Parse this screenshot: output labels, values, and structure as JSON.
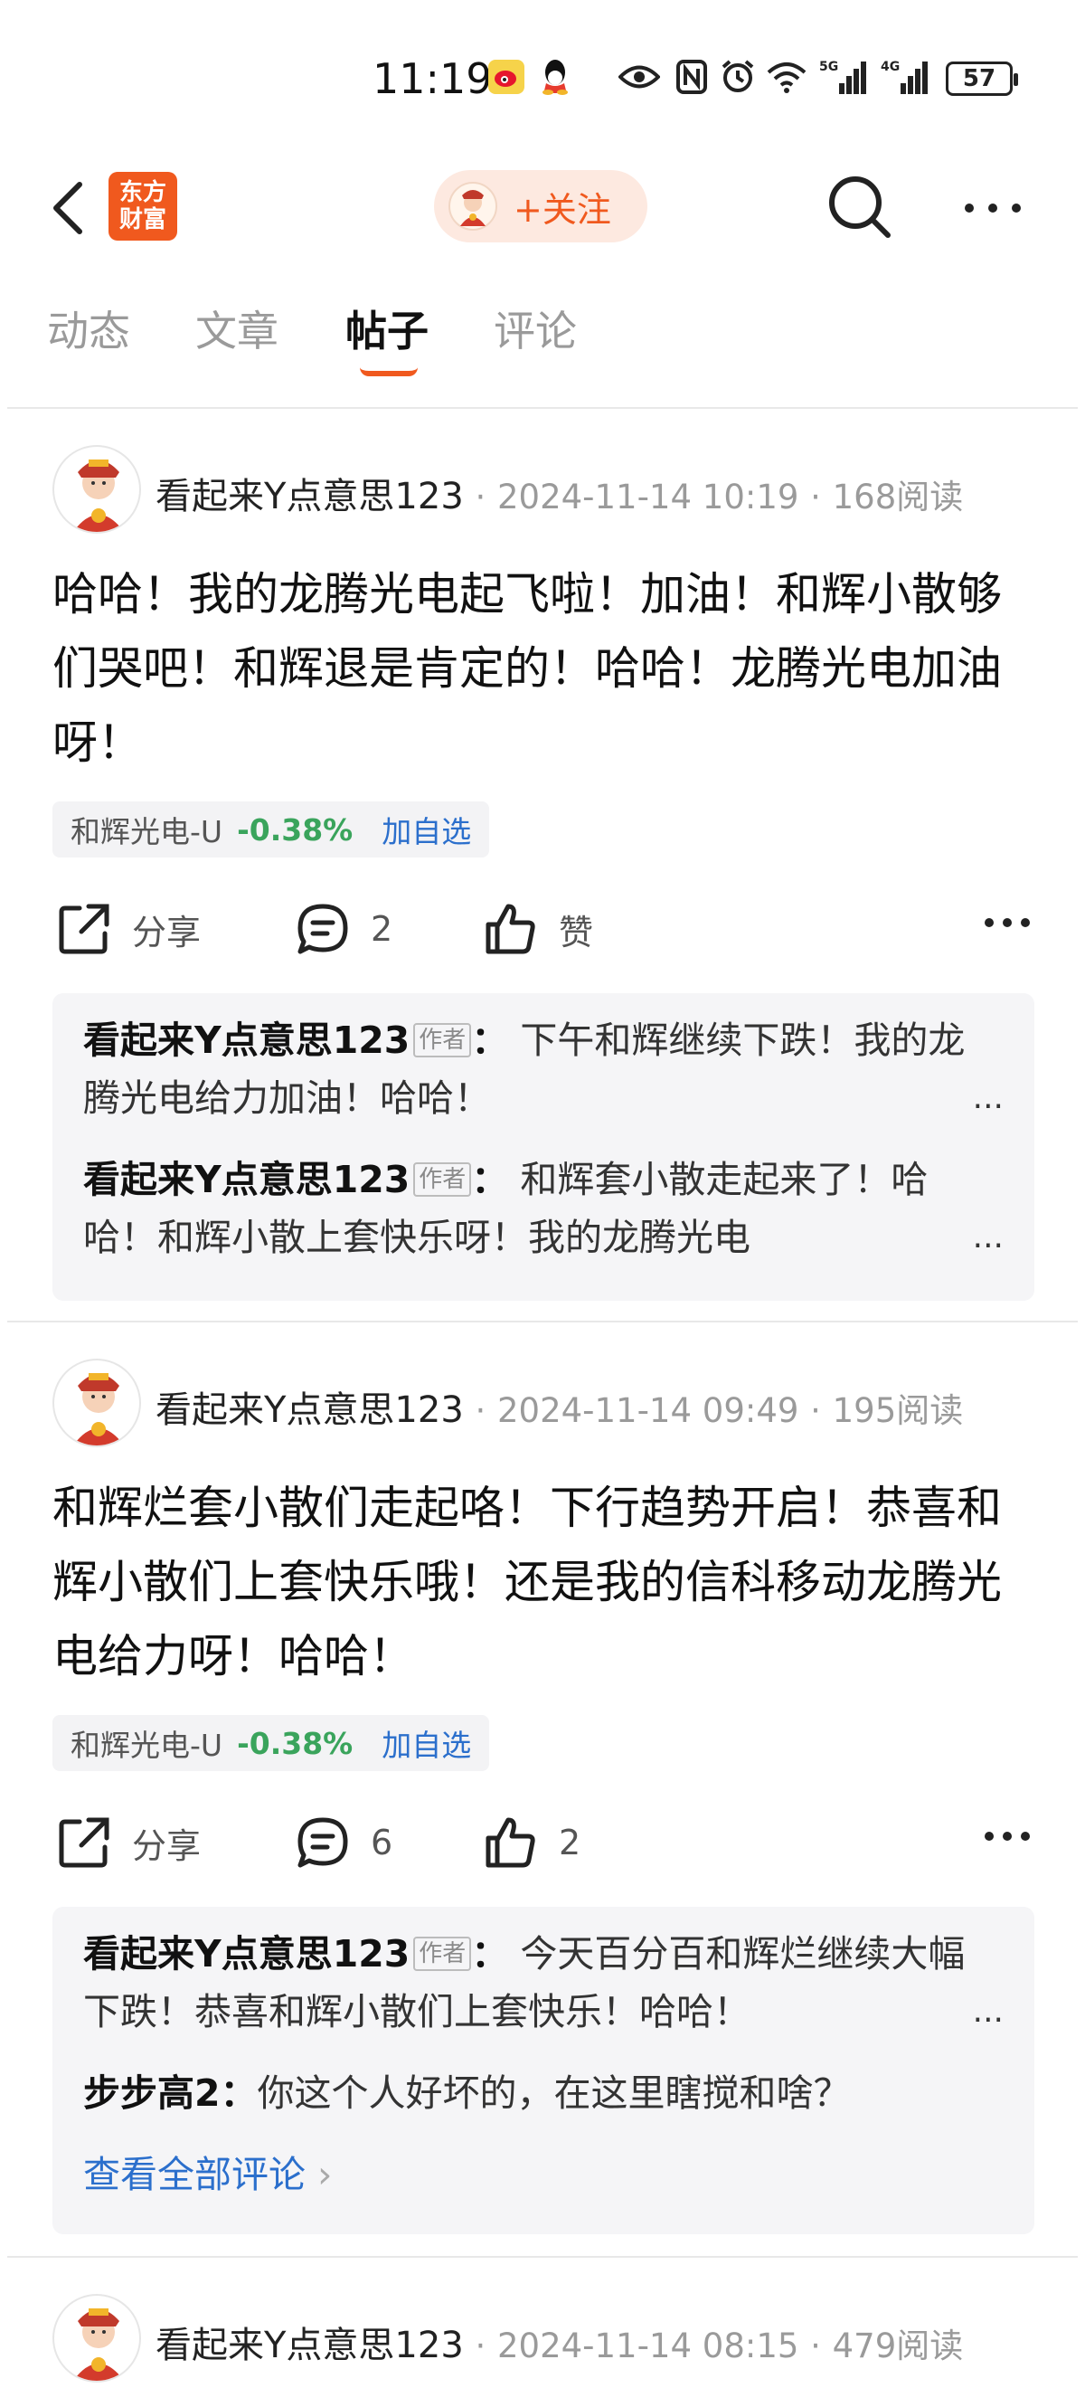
{
  "status_bar": {
    "time": "11:19",
    "battery": "57"
  },
  "header": {
    "logo_line1": "东方",
    "logo_line2": "财富",
    "follow_label": "+关注"
  },
  "tabs": [
    {
      "label": "动态"
    },
    {
      "label": "文章"
    },
    {
      "label": "帖子"
    },
    {
      "label": "评论"
    }
  ],
  "posts": [
    {
      "author": "看起来Y点意思123",
      "separator": "·",
      "date": "2024-11-14 10:19",
      "reads": "168阅读",
      "text": "哈哈！我的龙腾光电起飞啦！加油！和辉小散够们哭吧！和辉退是肯定的！哈哈！龙腾光电加油呀！",
      "stock": {
        "name": "和辉光电-U",
        "change": "-0.38%",
        "add": "加自选"
      },
      "share_label": "分享",
      "comment_count": "2",
      "like_label": "赞",
      "comments": [
        {
          "name": "看起来Y点意思123",
          "tag": "作者",
          "colon": "：",
          "text": "下午和辉继续下跌！我的龙腾光电给力加油！哈哈！",
          "ellipsis": "..."
        },
        {
          "name": "看起来Y点意思123",
          "tag": "作者",
          "colon": "：",
          "text": "和辉套小散走起来了！哈哈！和辉小散上套快乐呀！我的龙腾光电",
          "ellipsis": "..."
        }
      ]
    },
    {
      "author": "看起来Y点意思123",
      "separator": "·",
      "date": "2024-11-14 09:49",
      "reads": "195阅读",
      "text": "和辉烂套小散们走起咯！下行趋势开启！恭喜和辉小散们上套快乐哦！还是我的信科移动龙腾光电给力呀！哈哈！",
      "stock": {
        "name": "和辉光电-U",
        "change": "-0.38%",
        "add": "加自选"
      },
      "share_label": "分享",
      "comment_count": "6",
      "like_count": "2",
      "comments": [
        {
          "name": "看起来Y点意思123",
          "tag": "作者",
          "colon": "：",
          "text": "今天百分百和辉烂继续大幅下跌！恭喜和辉小散们上套快乐！哈哈！",
          "ellipsis": "..."
        },
        {
          "name": "步步高2",
          "colon": "：",
          "text": "你这个人好坏的，在这里瞎搅和啥？"
        }
      ],
      "view_all": "查看全部评论",
      "view_all_arrow": "›"
    },
    {
      "author": "看起来Y点意思123",
      "separator": "·",
      "date": "2024-11-14 08:15",
      "reads": "479阅读"
    }
  ]
}
